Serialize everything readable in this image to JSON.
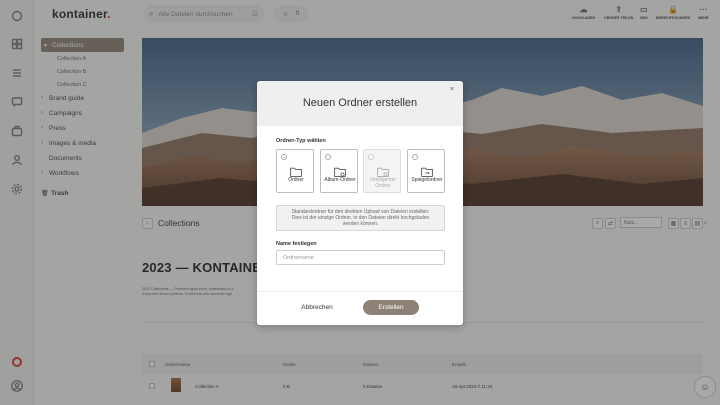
{
  "app": {
    "logo": "kontainer",
    "logo_dot": "."
  },
  "sidebar": {
    "items": [
      {
        "label": "Collections",
        "active": true
      },
      {
        "label": "Collection A"
      },
      {
        "label": "Collection B"
      },
      {
        "label": "Collection C"
      },
      {
        "label": "Brand guide"
      },
      {
        "label": "Campaigns"
      },
      {
        "label": "Press"
      },
      {
        "label": "Images & media"
      },
      {
        "label": "Documents"
      },
      {
        "label": "Workflows"
      },
      {
        "label": "Trash"
      }
    ]
  },
  "topbar": {
    "search_placeholder": "Alle Dateien durchsuchen",
    "favorites_count": "0",
    "actions": [
      "HOCHLADEN",
      "ORDNER TEILEN",
      "NEU",
      "BERECHTIGUNGEN",
      "MEHR"
    ]
  },
  "main": {
    "section_title": "Collections",
    "sort_label": "Nutz…",
    "heading": "2023 — KONTAINER I",
    "description_line1": "2023 Collections — Praesent ligula enim, malesuada id a",
    "description_line2": "lectus nec dictum pretium. In vehicula sem sed enim ege",
    "table": {
      "headers": [
        "Ordnername",
        "Größe",
        "Dateien",
        "Erstellt"
      ],
      "rows": [
        {
          "name": "Collection A",
          "size": "0 B",
          "files": "0 Dateien",
          "created": "18.Apr.2023 // 11:34"
        }
      ]
    }
  },
  "modal": {
    "title": "Neuen Ordner erstellen",
    "close": "×",
    "type_label": "Ordner-Typ wählen",
    "options": [
      {
        "label": "Ordner",
        "selected": true,
        "disabled": false
      },
      {
        "label": "Album-Ordner",
        "selected": false,
        "disabled": false
      },
      {
        "label": "Intelligenter Ordner",
        "selected": false,
        "disabled": true
      },
      {
        "label": "Spiegelordner",
        "selected": false,
        "disabled": false
      }
    ],
    "info_line1": "Standardordner für den direkten Upload von Dateien erstellen.",
    "info_line2": "Dies ist der einzige Ordner, in den Dateien direkt hochgeladen",
    "info_line3": "werden können.",
    "name_label": "Name festlegen",
    "name_placeholder": "Ordnername",
    "cancel_label": "Abbrechen",
    "create_label": "Erstellen"
  },
  "colors": {
    "accent": "#8d8275",
    "brand_dot": "#c9342b"
  }
}
